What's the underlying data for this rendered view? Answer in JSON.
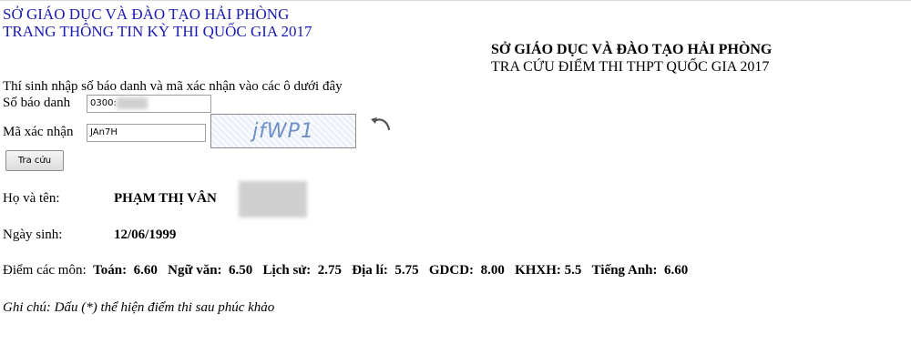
{
  "header": {
    "line1": "SỞ GIÁO DỤC VÀ ĐÀO TẠO HẢI PHÒNG",
    "line2": "TRANG THÔNG TIN KỲ THI QUỐC GIA 2017"
  },
  "title_right": {
    "line1": "SỞ GIÁO DỤC VÀ ĐÀO TẠO HẢI PHÒNG",
    "line2": "TRA CỨU ĐIỂM THI THPT QUỐC GIA 2017"
  },
  "form": {
    "instruction": "Thí sinh nhập số báo danh và mã xác nhận vào các ô dưới đây",
    "sbd_label": "Số báo danh",
    "sbd_value": "0300:",
    "captcha_label": "Mã xác nhận",
    "captcha_value": "JAn7H",
    "captcha_image_text": "jfWP1",
    "submit_label": "Tra cứu"
  },
  "result": {
    "name_label": "Họ và tên:",
    "name_value": "PHẠM THỊ VÂN",
    "dob_label": "Ngày sinh:",
    "dob_value": "12/06/1999",
    "scores_label": "Điểm các môn:",
    "scores": [
      {
        "subject": "Toán:",
        "score": "6.60"
      },
      {
        "subject": "Ngữ văn:",
        "score": "6.50"
      },
      {
        "subject": "Lịch sử:",
        "score": "2.75"
      },
      {
        "subject": "Địa lí:",
        "score": "5.75"
      },
      {
        "subject": "GDCD:",
        "score": "8.00"
      },
      {
        "subject": "KHXH:",
        "score": "5.5"
      },
      {
        "subject": "Tiếng Anh:",
        "score": "6.60"
      }
    ]
  },
  "note": "Ghi chú: Dấu (*) thể hiện điểm thi sau phúc khảo",
  "colors": {
    "header_text": "#1a1ab4",
    "captcha_text": "#6f8fc8"
  }
}
